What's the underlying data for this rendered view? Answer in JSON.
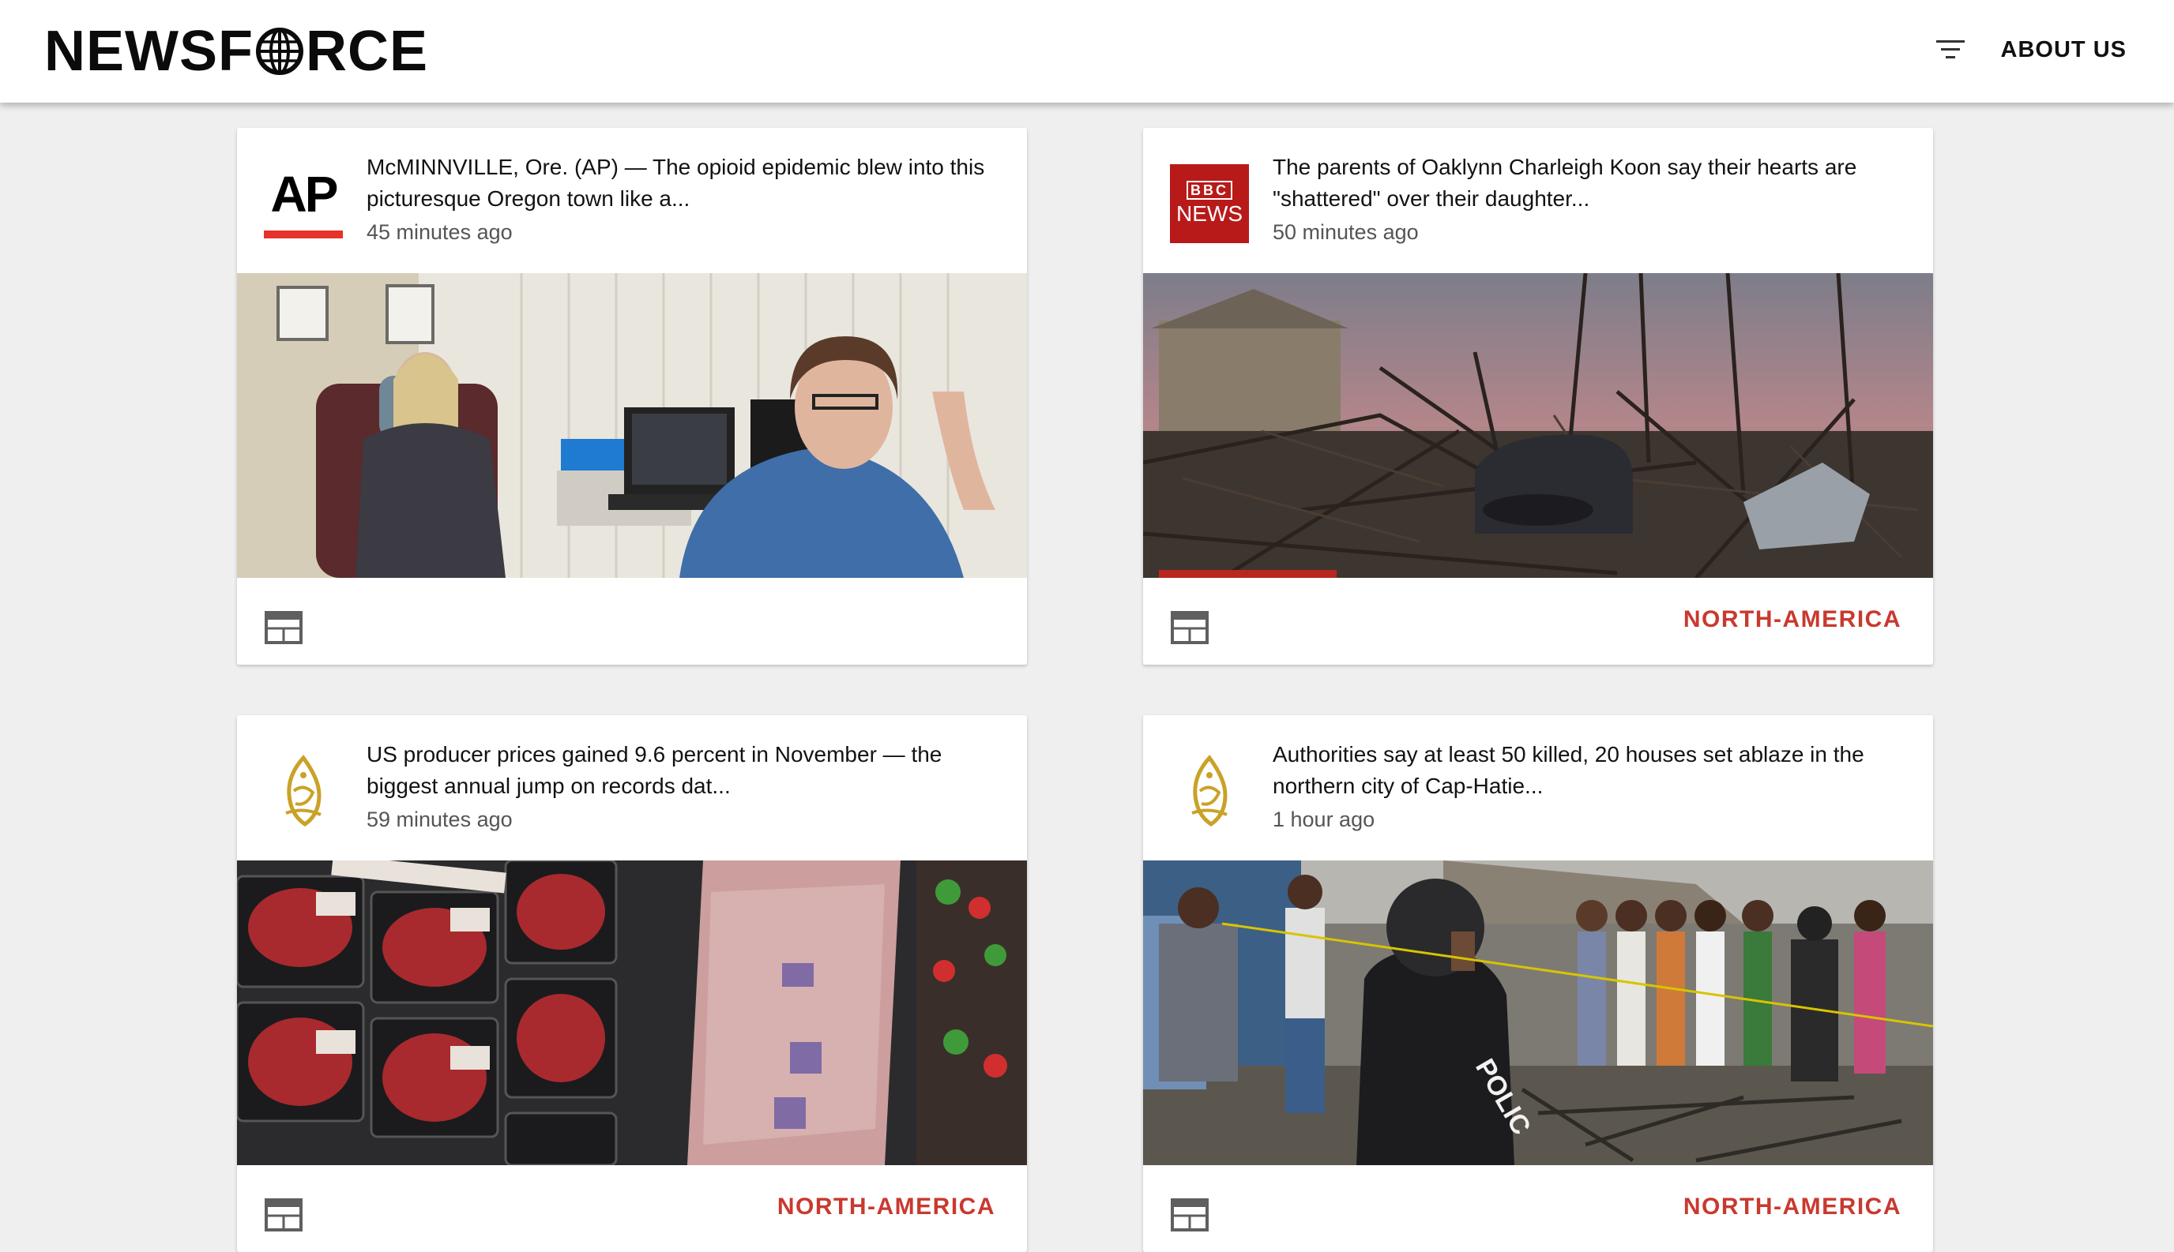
{
  "header": {
    "logo_left": "NEWSF",
    "logo_right": "RCE",
    "about_label": "ABOUT US",
    "filter_icon": "filter-list-icon"
  },
  "cards": [
    {
      "source": "AP",
      "headline": "McMINNVILLE, Ore. (AP) — The opioid epidemic blew into this picturesque Oregon town like a...",
      "time": "45 minutes ago",
      "region": "",
      "image": "two women seated in an office",
      "icon": "calendar-icon"
    },
    {
      "source": "BBC NEWS",
      "headline": "The parents of Oaklynn Charleigh Koon say their hearts are \"shattered\" over their daughter...",
      "time": "50 minutes ago",
      "region": "NORTH-AMERICA",
      "image": "tornado damage with wrecked car",
      "icon": "calendar-icon"
    },
    {
      "source": "Al Jazeera",
      "headline": "US producer prices gained 9.6 percent in November — the biggest annual jump on records dat...",
      "time": "59 minutes ago",
      "region": "NORTH-AMERICA",
      "image": "packaged beef steaks",
      "icon": "calendar-icon"
    },
    {
      "source": "Al Jazeera",
      "headline": "Authorities say at least 50 killed, 20 houses set ablaze in the northern city of Cap-Hatie...",
      "time": "1 hour ago",
      "region": "NORTH-AMERICA",
      "image": "police officer at burned site with crowd",
      "icon": "calendar-icon"
    }
  ],
  "bbc_logo": {
    "top": "BBC",
    "bottom": "NEWS"
  },
  "colors": {
    "region": "#c9392f",
    "ap_bar": "#e6322b",
    "bbc_red": "#b81a1a",
    "aj_gold": "#c9a227"
  }
}
